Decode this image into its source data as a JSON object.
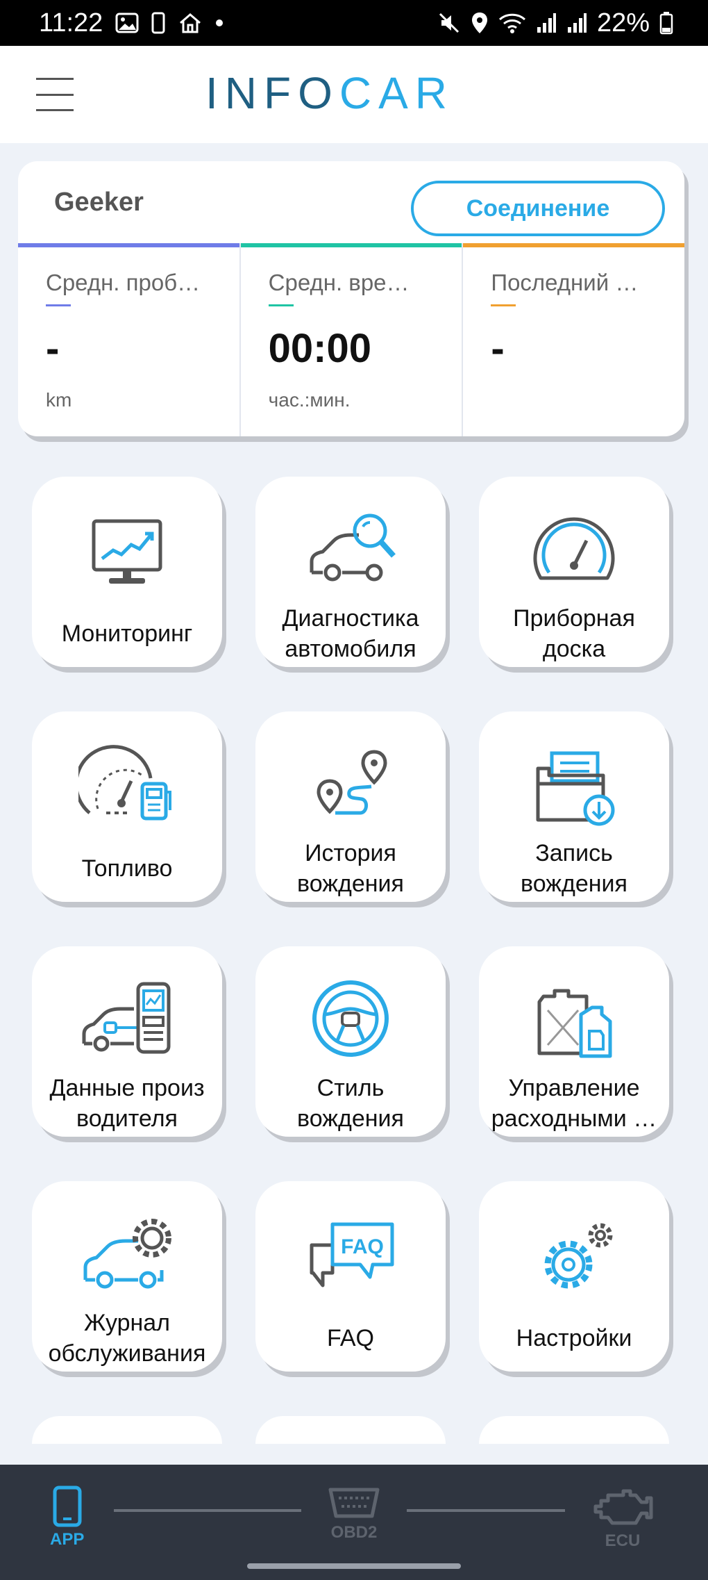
{
  "status_bar": {
    "time": "11:22",
    "battery": "22%"
  },
  "app_bar": {
    "logo_part1": "INFO",
    "logo_part2": "CAR"
  },
  "stats": {
    "device_name": "Geeker",
    "connect_label": "Соединение",
    "columns": [
      {
        "label": "Средн. проб…",
        "value": "-",
        "unit": "km",
        "color": "#6f7ce8"
      },
      {
        "label": "Средн. вре…",
        "value": "00:00",
        "unit": "час.:мин.",
        "color": "#1fc4a4"
      },
      {
        "label": "Последний …",
        "value": "-",
        "unit": "",
        "color": "#f0a030"
      }
    ]
  },
  "tiles": [
    {
      "label": "Мониторинг",
      "icon": "monitor-chart-icon"
    },
    {
      "label": "Диагностика\nавтомобиля",
      "icon": "car-diagnostics-icon"
    },
    {
      "label": "Приборная\nдоска",
      "icon": "dashboard-gauge-icon"
    },
    {
      "label": "Топливо",
      "icon": "fuel-gauge-icon"
    },
    {
      "label": "История\nвождения",
      "icon": "route-history-icon"
    },
    {
      "label": "Запись\nвождения",
      "icon": "folder-record-icon"
    },
    {
      "label": "Данные произ\nводителя",
      "icon": "car-scanner-icon"
    },
    {
      "label": "Стиль\nвождения",
      "icon": "steering-wheel-icon"
    },
    {
      "label": "Управление\nрасходными …",
      "icon": "canister-icon"
    },
    {
      "label": "Журнал\nобслуживания",
      "icon": "car-gear-icon"
    },
    {
      "label": "FAQ",
      "icon": "faq-bubble-icon"
    },
    {
      "label": "Настройки",
      "icon": "settings-gears-icon"
    }
  ],
  "bottom_nav": {
    "items": [
      {
        "label": "APP",
        "active": true
      },
      {
        "label": "OBD2",
        "active": false
      },
      {
        "label": "ECU",
        "active": false
      }
    ],
    "active_color": "#2aaae6",
    "inactive_color": "#5e646e"
  }
}
